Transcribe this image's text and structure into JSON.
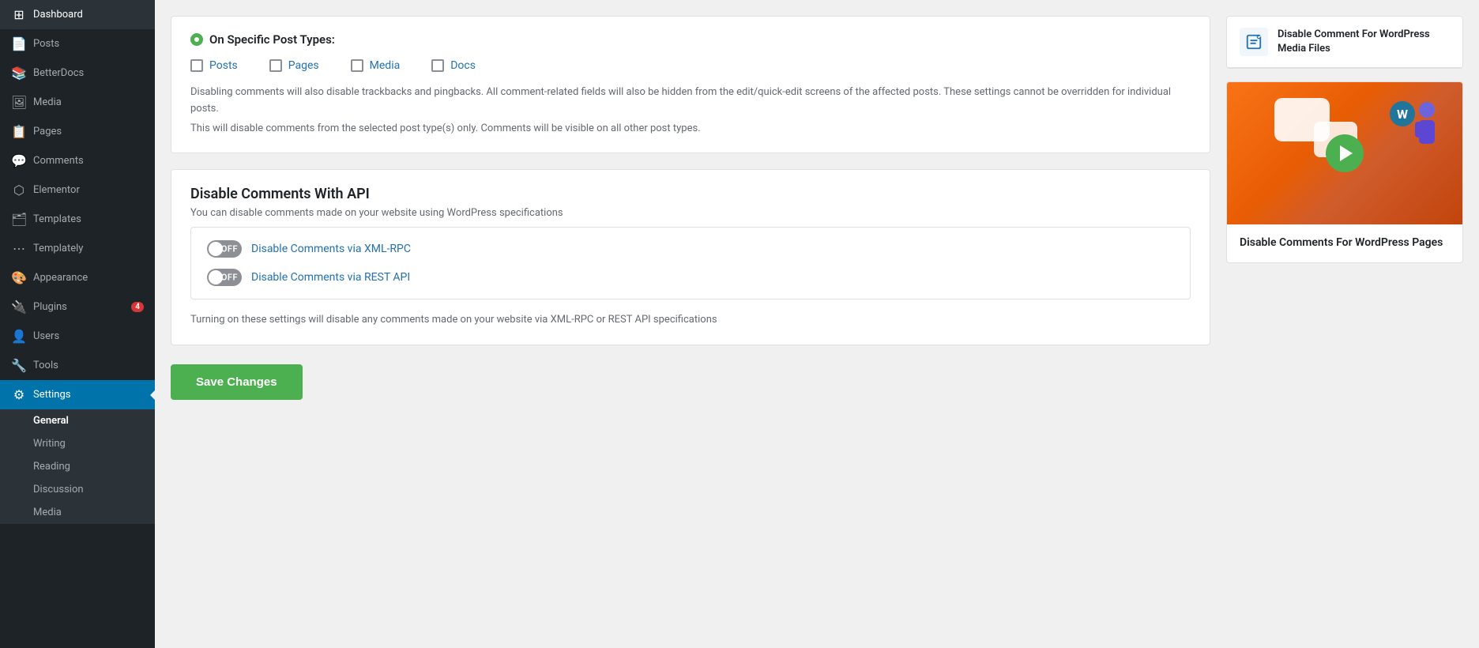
{
  "sidebar": {
    "items": [
      {
        "id": "dashboard",
        "label": "Dashboard",
        "icon": "⊞"
      },
      {
        "id": "posts",
        "label": "Posts",
        "icon": "📄"
      },
      {
        "id": "betterdocs",
        "label": "BetterDocs",
        "icon": "📚"
      },
      {
        "id": "media",
        "label": "Media",
        "icon": "🖼"
      },
      {
        "id": "pages",
        "label": "Pages",
        "icon": "📋"
      },
      {
        "id": "comments",
        "label": "Comments",
        "icon": "💬"
      },
      {
        "id": "elementor",
        "label": "Elementor",
        "icon": "⬡"
      },
      {
        "id": "templates",
        "label": "Templates",
        "icon": "🗂"
      },
      {
        "id": "templately",
        "label": "Templately",
        "icon": "⋯"
      },
      {
        "id": "appearance",
        "label": "Appearance",
        "icon": "🎨"
      },
      {
        "id": "plugins",
        "label": "Plugins",
        "icon": "🔌",
        "badge": "4"
      },
      {
        "id": "users",
        "label": "Users",
        "icon": "👤"
      },
      {
        "id": "tools",
        "label": "Tools",
        "icon": "🔧"
      },
      {
        "id": "settings",
        "label": "Settings",
        "icon": "⚙",
        "active": true
      }
    ],
    "submenu": {
      "items": [
        {
          "id": "general",
          "label": "General",
          "active": true
        },
        {
          "id": "writing",
          "label": "Writing"
        },
        {
          "id": "reading",
          "label": "Reading"
        },
        {
          "id": "discussion",
          "label": "Discussion"
        },
        {
          "id": "media",
          "label": "Media"
        }
      ]
    }
  },
  "post_types": {
    "heading": "On Specific Post Types:",
    "checkboxes": [
      {
        "id": "posts",
        "label": "Posts"
      },
      {
        "id": "pages",
        "label": "Pages"
      },
      {
        "id": "media",
        "label": "Media"
      },
      {
        "id": "docs",
        "label": "Docs"
      }
    ],
    "info_line1": "Disabling comments will also disable trackbacks and pingbacks. All comment-related fields will also be hidden from the edit/quick-edit screens of the affected posts. These settings cannot be overridden for individual posts.",
    "info_line2": "This will disable comments from the selected post type(s) only. Comments will be visible on all other post types."
  },
  "api_section": {
    "title": "Disable Comments With API",
    "description": "You can disable comments made on your website using WordPress specifications",
    "toggles": [
      {
        "id": "xml-rpc",
        "label": "Disable Comments via XML-RPC",
        "state": "OFF"
      },
      {
        "id": "rest-api",
        "label": "Disable Comments via REST API",
        "state": "OFF"
      }
    ],
    "footer_text": "Turning on these settings will disable any comments made on your website via XML-RPC or REST API specifications"
  },
  "save_button": {
    "label": "Save Changes"
  },
  "right_sidebar": {
    "promo_card": {
      "title": "Disable Comment For WordPress Media Files",
      "icon": "📝"
    },
    "video_card": {
      "title": "Disable Comments For WordPress Pages",
      "play_label": "▶"
    }
  }
}
